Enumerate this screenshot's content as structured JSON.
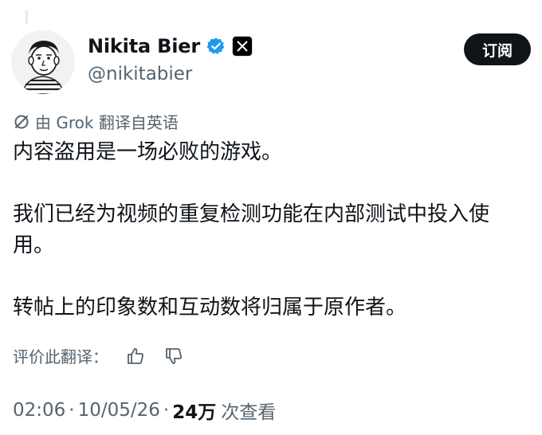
{
  "author": {
    "name": "Nikita Bier",
    "handle": "@nikitabier"
  },
  "header": {
    "subscribe_label": "订阅"
  },
  "translation": {
    "label": "由 Grok 翻译自英语"
  },
  "post": {
    "lines": [
      "内容盗用是一场必败的游戏。",
      "我们已经为视频的重复检测功能在内部测试中投入使用。",
      "转帖上的印象数和互动数将归属于原作者。"
    ]
  },
  "rating": {
    "label": "评价此翻译："
  },
  "meta": {
    "time": "02:06",
    "date": "10/05/26",
    "views_count": "24万",
    "views_label": "次查看",
    "separator": "·"
  },
  "colors": {
    "verified": "#1d9bf0",
    "text_primary": "#0f1419",
    "text_secondary": "#536471"
  }
}
